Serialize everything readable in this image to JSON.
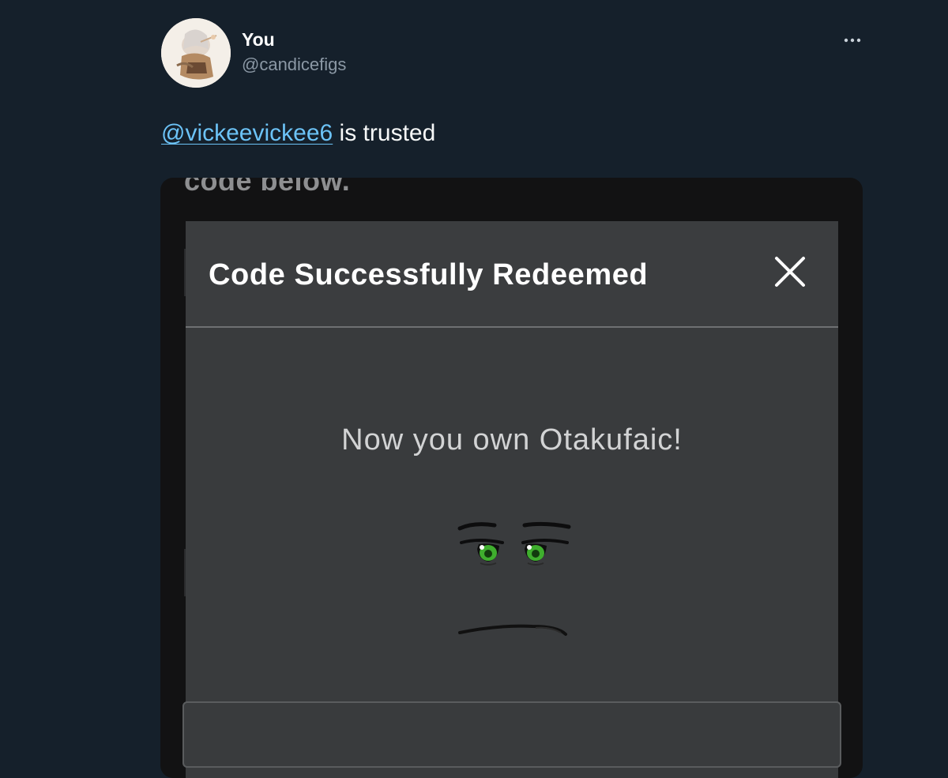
{
  "tweet": {
    "author": {
      "display_name": "You",
      "handle": "@candicefigs"
    },
    "text": {
      "mention": "@vickeevickee6",
      "rest": " is trusted"
    },
    "more_icon": "more-horizontal-icon"
  },
  "media": {
    "caption": "code below.",
    "modal": {
      "title": "Code Successfully Redeemed",
      "close_icon": "close-icon",
      "message": "Now you own Otakufaic!",
      "item_icon": "otakufaic-face-icon"
    }
  },
  "colors": {
    "background": "#15202b",
    "mention": "#6cc3f7",
    "modal": "#393b3d",
    "eyes": "#3fae2e"
  }
}
